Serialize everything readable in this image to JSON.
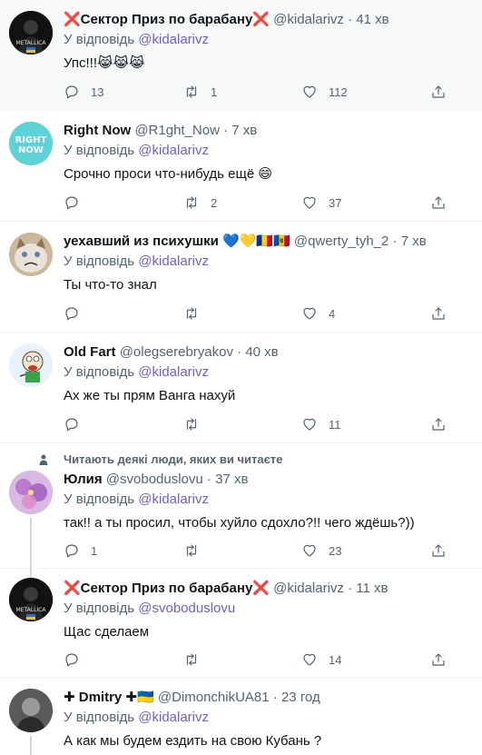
{
  "tweets": [
    {
      "name": "❌Сектор Приз по барабану❌",
      "handle": "@kidalarivz",
      "time": "41 хв",
      "reply_prefix": "У відповідь",
      "reply_to": "@kidalarivz",
      "text": "Упс!!!😹😹😹",
      "replies": "13",
      "retweets": "1",
      "likes": "112",
      "avatar_icon": "dark-avatar-metallica-icon"
    },
    {
      "name": "Right Now",
      "handle": "@R1ght_Now",
      "time": "7 хв",
      "reply_prefix": "У відповідь",
      "reply_to": "@kidalarivz",
      "text": "Срочно проси что-нибудь ещё 😄",
      "replies": "",
      "retweets": "2",
      "likes": "37",
      "avatar_text": "RIGHT NOW"
    },
    {
      "name": "уехавший из психушки 💙💛🇷🇴🇲🇩",
      "handle": "@qwerty_tyh_2",
      "time": "7 хв",
      "reply_prefix": "У відповідь",
      "reply_to": "@kidalarivz",
      "text": "Ты что-то знал",
      "replies": "",
      "retweets": "",
      "likes": "4",
      "avatar_icon": "grumpy-cat-icon"
    },
    {
      "name": "Old Fart",
      "handle": "@olegserebryakov",
      "time": "40 хв",
      "reply_prefix": "У відповідь",
      "reply_to": "@kidalarivz",
      "text": "Ах же ты прям Ванга нахуй",
      "replies": "",
      "retweets": "",
      "likes": "11",
      "avatar_icon": "cartoon-face-icon"
    },
    {
      "social_context": "Читають деякі люди, яких ви читаєте",
      "name": "Юлия",
      "handle": "@svoboduslovu",
      "time": "37 хв",
      "reply_prefix": "У відповідь",
      "reply_to": "@kidalarivz",
      "text": "так!! а ты просил, чтобы хуйло сдохло?!! чего ждёшь?))",
      "replies": "1",
      "retweets": "",
      "likes": "23",
      "avatar_icon": "purple-flower-icon"
    },
    {
      "name": "❌Сектор Приз по барабану❌",
      "handle": "@kidalarivz",
      "time": "11 хв",
      "reply_prefix": "У відповідь",
      "reply_to": "@svoboduslovu",
      "text": "Щас сделаем",
      "replies": "",
      "retweets": "",
      "likes": "14",
      "avatar_icon": "dark-avatar-metallica-icon"
    },
    {
      "name": "✚ Dmitry ✚🇺🇦",
      "handle": "@DimonchikUA81",
      "time": "23 год",
      "reply_prefix": "У відповідь",
      "reply_to": "@kidalarivz",
      "text": "А как мы будем ездить на свою Кубань ?",
      "avatar_icon": "bw-portrait-icon"
    }
  ],
  "colors": {
    "link": "#6c5fd6",
    "secondary": "#536471",
    "highlight_bg": "#f7f9f9"
  }
}
